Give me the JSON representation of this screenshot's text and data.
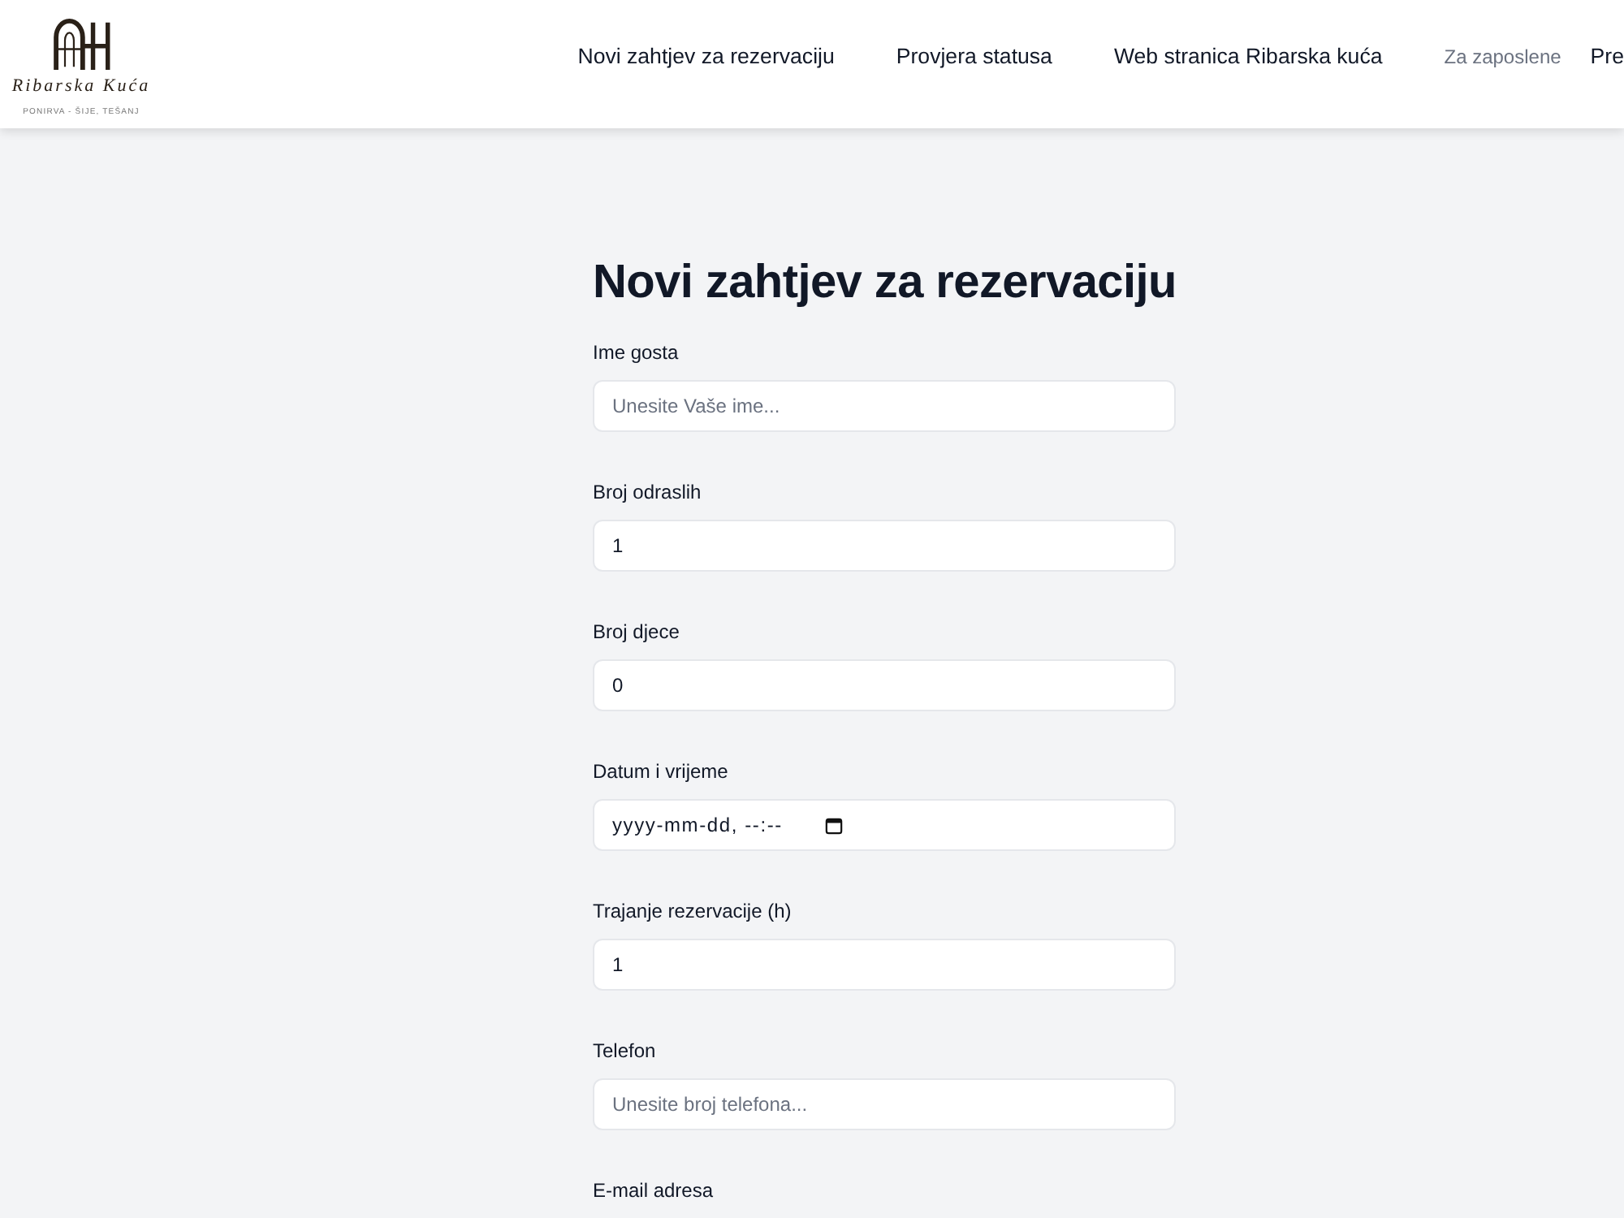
{
  "header": {
    "logo": {
      "name": "Ribarska Kuća",
      "tagline": "PONIRVA - ŠIJE, TEŠANJ"
    },
    "nav": [
      {
        "label": "Novi zahtjev za rezervaciju",
        "kind": "main"
      },
      {
        "label": "Provjera statusa",
        "kind": "main"
      },
      {
        "label": "Web stranica Ribarska kuća",
        "kind": "main"
      },
      {
        "label": "Za zaposlene",
        "kind": "muted"
      },
      {
        "label": "Pre",
        "kind": "main"
      }
    ]
  },
  "form": {
    "title": "Novi zahtjev za rezervaciju",
    "fields": [
      {
        "label": "Ime gosta",
        "kind": "text",
        "placeholder": "Unesite Vaše ime..."
      },
      {
        "label": "Broj odraslih",
        "kind": "number",
        "value": "1"
      },
      {
        "label": "Broj djece",
        "kind": "number",
        "value": "0"
      },
      {
        "label": "Datum i vrijeme",
        "kind": "datetime",
        "placeholder": "yyyy-mm-dd, --:--"
      },
      {
        "label": "Trajanje rezervacije (h)",
        "kind": "number",
        "value": "1"
      },
      {
        "label": "Telefon",
        "kind": "text",
        "placeholder": "Unesite broj telefona..."
      },
      {
        "label": "E-mail adresa",
        "kind": "text"
      }
    ]
  }
}
